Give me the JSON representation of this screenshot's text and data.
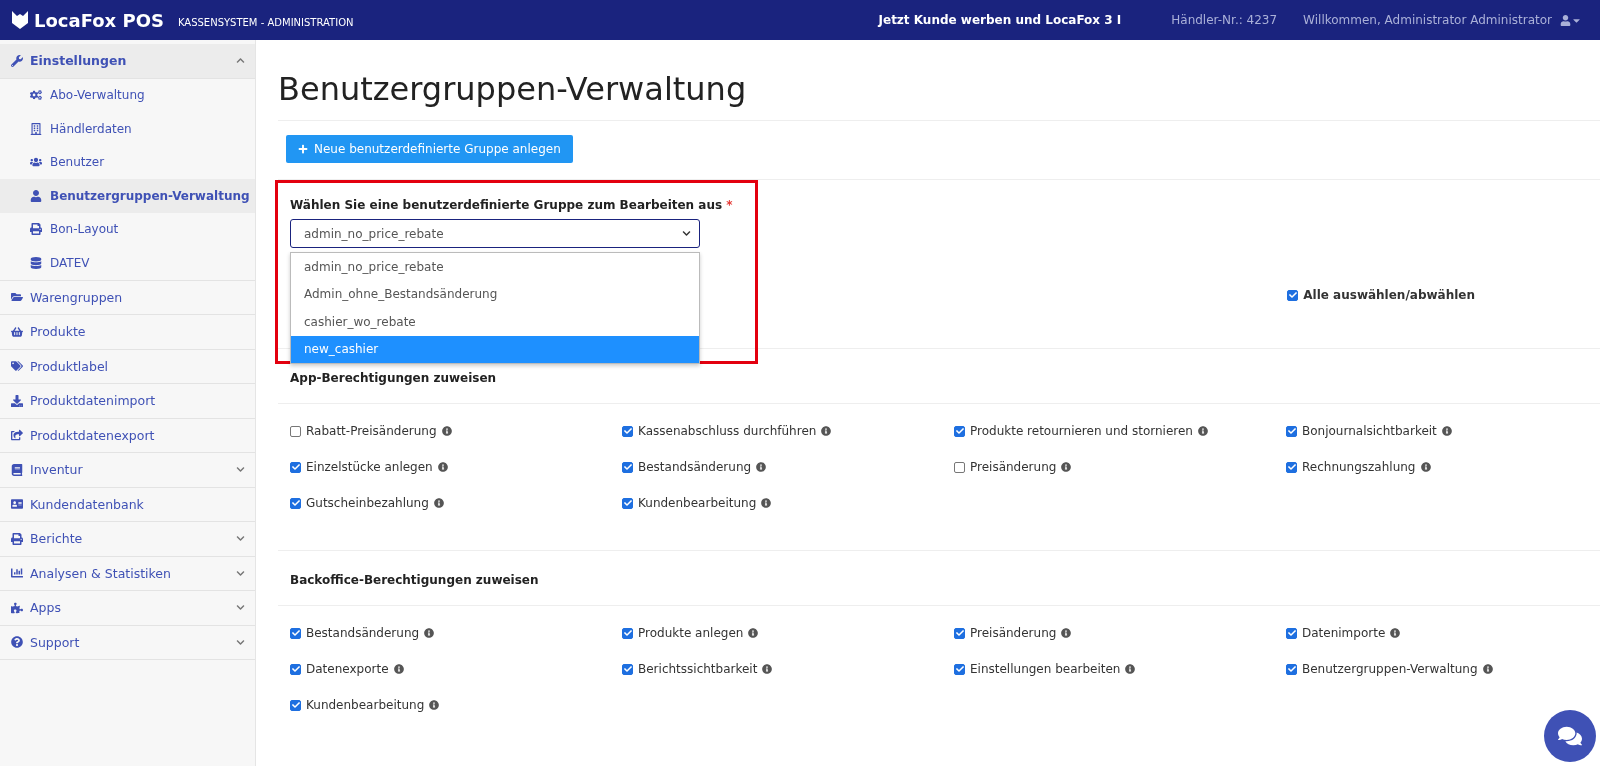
{
  "header": {
    "logo": "LocaFox POS",
    "subtitle": "KASSENSYSTEM - ADMINISTRATION",
    "promo": "Jetzt Kunde werben und LocaFox 3 I",
    "merchant_no": "Händler-Nr.: 4237",
    "welcome": "Willkommen, Administrator Administrator"
  },
  "sidebar": {
    "items": [
      {
        "label": "Einstellungen",
        "collapsible": true,
        "expanded": true,
        "children": [
          {
            "label": "Abo-Verwaltung",
            "selected": false
          },
          {
            "label": "Händlerdaten",
            "selected": false
          },
          {
            "label": "Benutzer",
            "selected": false
          },
          {
            "label": "Benutzergruppen-Verwaltung",
            "selected": true
          },
          {
            "label": "Bon-Layout",
            "selected": false
          },
          {
            "label": "DATEV",
            "selected": false
          }
        ]
      },
      {
        "label": "Warengruppen",
        "collapsible": false,
        "expanded": false
      },
      {
        "label": "Produkte",
        "collapsible": false,
        "expanded": false
      },
      {
        "label": "Produktlabel",
        "collapsible": false,
        "expanded": false
      },
      {
        "label": "Produktdatenimport",
        "collapsible": false,
        "expanded": false
      },
      {
        "label": "Produktdatenexport",
        "collapsible": false,
        "expanded": false
      },
      {
        "label": "Inventur",
        "collapsible": true,
        "expanded": false
      },
      {
        "label": "Kundendatenbank",
        "collapsible": false,
        "expanded": false
      },
      {
        "label": "Berichte",
        "collapsible": true,
        "expanded": false
      },
      {
        "label": "Analysen & Statistiken",
        "collapsible": true,
        "expanded": false
      },
      {
        "label": "Apps",
        "collapsible": true,
        "expanded": false
      },
      {
        "label": "Support",
        "collapsible": true,
        "expanded": false
      }
    ]
  },
  "page": {
    "title": "Benutzergruppen-Verwaltung",
    "new_group_button": "Neue benutzerdefinierte Gruppe anlegen",
    "group_select": {
      "label": "Wählen Sie eine benutzerdefinierte Gruppe zum Bearbeiten aus",
      "required_mark": "*",
      "value": "admin_no_price_rebate",
      "open": true,
      "options": [
        {
          "label": "admin_no_price_rebate",
          "highlighted": false
        },
        {
          "label": "Admin_ohne_Bestandsänderung",
          "highlighted": false
        },
        {
          "label": "cashier_wo_rebate",
          "highlighted": false
        },
        {
          "label": "new_cashier",
          "highlighted": true
        }
      ]
    },
    "select_all": {
      "label": "Alle auswählen/abwählen",
      "checked": true
    },
    "sections": [
      {
        "title": "App-Berechtigungen zuweisen",
        "permissions": [
          {
            "label": "Rabatt-Preisänderung",
            "checked": false
          },
          {
            "label": "Kassenabschluss durchführen",
            "checked": true
          },
          {
            "label": "Produkte retournieren und stornieren",
            "checked": true
          },
          {
            "label": "Bonjournalsichtbarkeit",
            "checked": true
          },
          {
            "label": "Einzelstücke anlegen",
            "checked": true
          },
          {
            "label": "Bestandsänderung",
            "checked": true
          },
          {
            "label": "Preisänderung",
            "checked": false
          },
          {
            "label": "Rechnungszahlung",
            "checked": true
          },
          {
            "label": "Gutscheinbezahlung",
            "checked": true
          },
          {
            "label": "Kundenbearbeitung",
            "checked": true
          }
        ]
      },
      {
        "title": "Backoffice-Berechtigungen zuweisen",
        "permissions": [
          {
            "label": "Bestandsänderung",
            "checked": true
          },
          {
            "label": "Produkte anlegen",
            "checked": true
          },
          {
            "label": "Preisänderung",
            "checked": true
          },
          {
            "label": "Datenimporte",
            "checked": true
          },
          {
            "label": "Datenexporte",
            "checked": true
          },
          {
            "label": "Berichtssichtbarkeit",
            "checked": true
          },
          {
            "label": "Einstellungen bearbeiten",
            "checked": true
          },
          {
            "label": "Benutzergruppen-Verwaltung",
            "checked": true
          },
          {
            "label": "Kundenbearbeitung",
            "checked": true
          }
        ]
      }
    ]
  }
}
